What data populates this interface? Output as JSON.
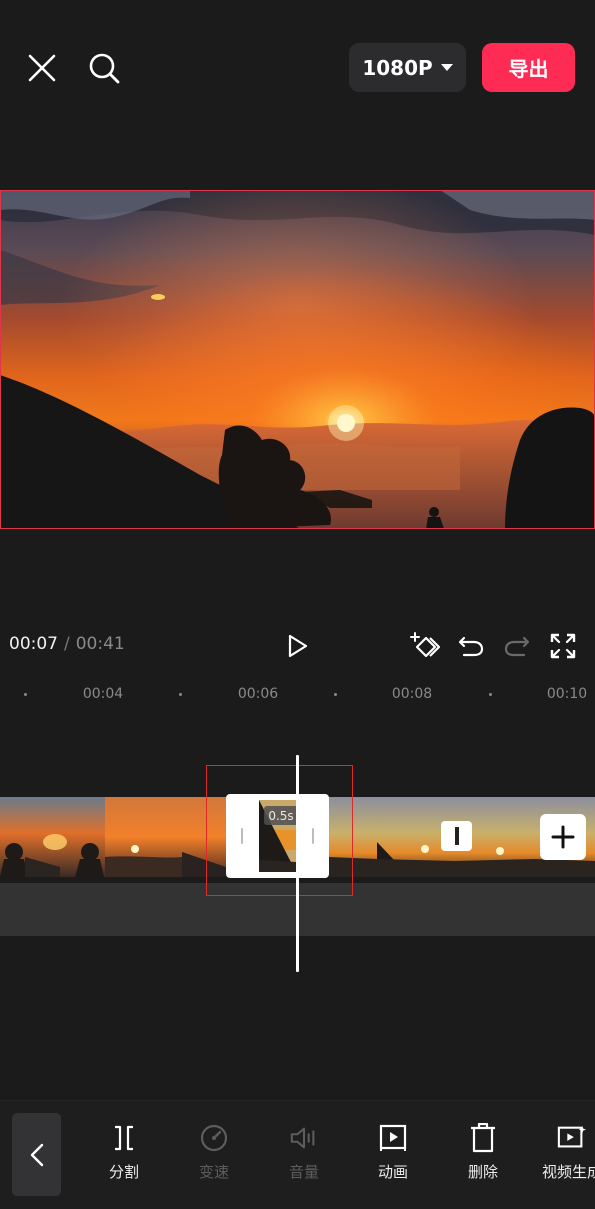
{
  "topbar": {
    "resolution": "1080P",
    "export_label": "导出"
  },
  "playback": {
    "current_time": "00:07",
    "separator": "/",
    "total_time": "00:41"
  },
  "ruler": {
    "labels": [
      "00:04",
      "00:06",
      "00:08",
      "00:10"
    ]
  },
  "timeline": {
    "selected_clip_duration": "0.5s"
  },
  "toolbar": {
    "items": [
      {
        "label": "分割",
        "icon": "split-icon",
        "enabled": true
      },
      {
        "label": "变速",
        "icon": "speed-icon",
        "enabled": false
      },
      {
        "label": "音量",
        "icon": "volume-icon",
        "enabled": false
      },
      {
        "label": "动画",
        "icon": "animation-icon",
        "enabled": true
      },
      {
        "label": "删除",
        "icon": "delete-icon",
        "enabled": true
      },
      {
        "label": "视频生成",
        "icon": "video-generate-icon",
        "enabled": true
      }
    ]
  },
  "colors": {
    "background": "#1b1b1b",
    "accent": "#fe2c55",
    "selection": "#e02a2a"
  }
}
